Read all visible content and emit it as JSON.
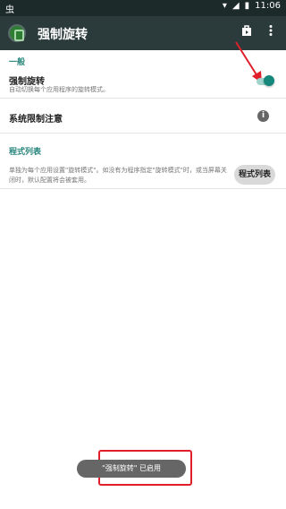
{
  "status_bar": {
    "left_icon": "虫",
    "time": "11:06",
    "icons": [
      "wifi-icon",
      "signal-icon",
      "battery-icon"
    ]
  },
  "appbar": {
    "title": "强制旋转",
    "icons": [
      "app-logo-icon",
      "store-icon",
      "overflow-menu-icon"
    ]
  },
  "sections": {
    "general": {
      "header": "一般",
      "force_rotation": {
        "title": "强制旋转",
        "subtitle": "自动切换每个应用程序的旋转模式。",
        "enabled": true
      },
      "system_restrictions": {
        "title": "系统限制注意"
      }
    },
    "app_list": {
      "header": "程式列表",
      "description": "单独为每个应用设置\"旋转模式\"。如没有为程序指定\"旋转模式\"时，或当屏幕关闭时，默认配置将会被套用。",
      "button_label": "程式列表"
    }
  },
  "toast": {
    "text": "\"强制旋转\" 已启用"
  },
  "colors": {
    "accent": "#15877b",
    "appbar": "#2b3a3a",
    "statusbar": "#1d2a2a",
    "highlight": "#e01f2a"
  }
}
